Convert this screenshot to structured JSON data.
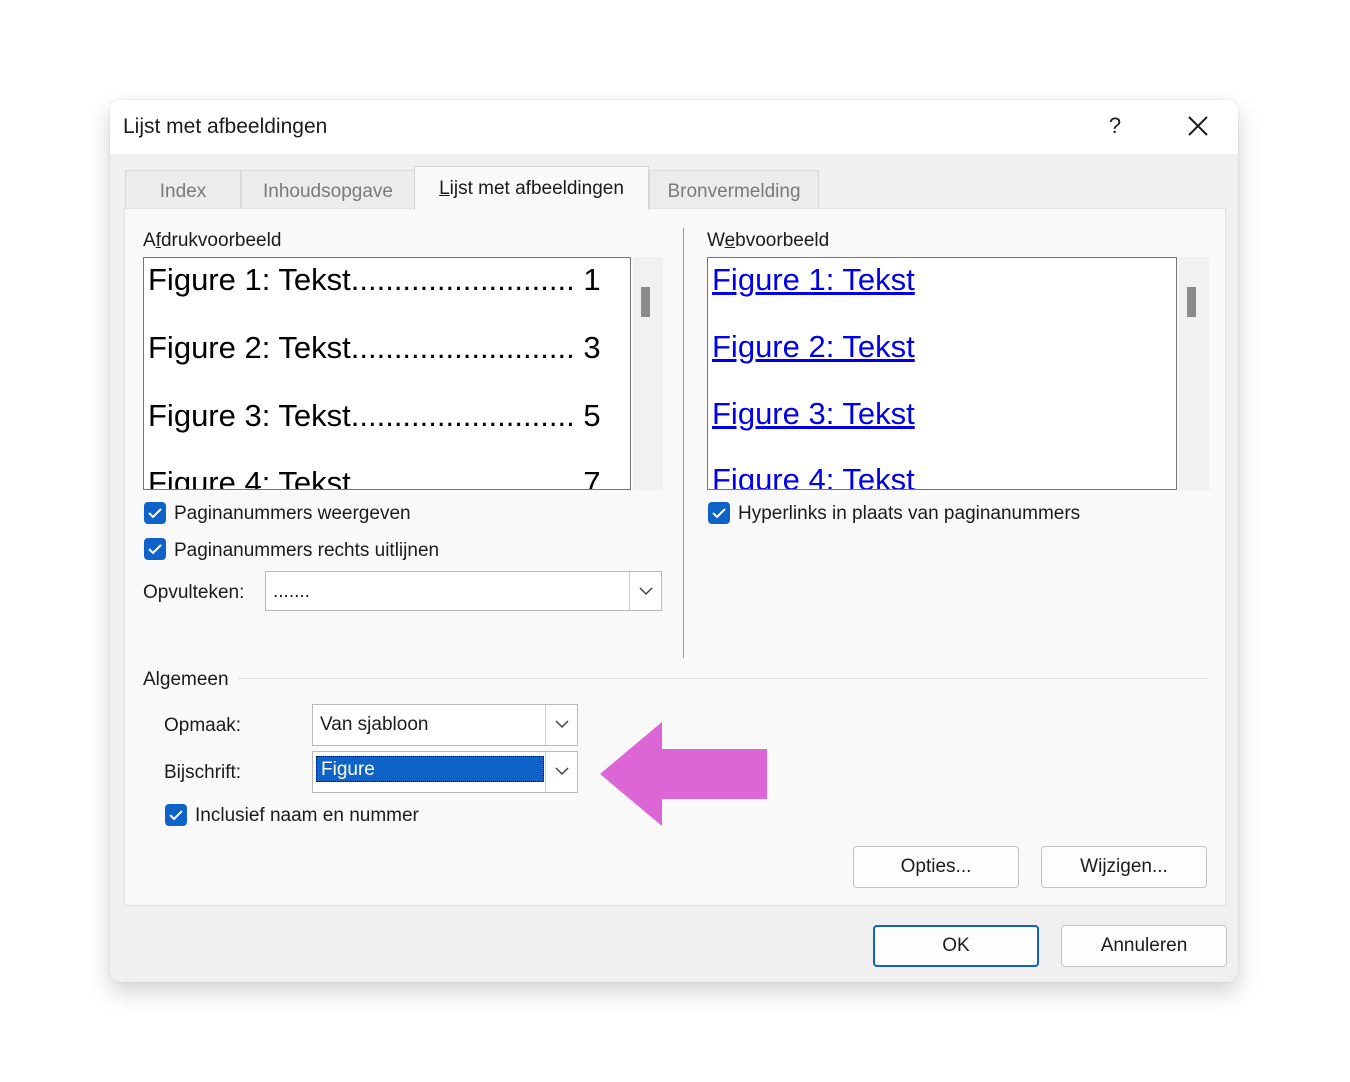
{
  "dialog": {
    "title": "Lijst met afbeeldingen",
    "help_label": "?",
    "close_icon": "close-icon"
  },
  "tabs": [
    {
      "label": "Index",
      "active": false
    },
    {
      "label": "Inhoudsopgave",
      "active": false
    },
    {
      "label": "Lijst met afbeeldingen",
      "active": true
    },
    {
      "label": "Bronvermelding",
      "active": false
    }
  ],
  "print_preview": {
    "label": "Afdrukvoorbeeld",
    "rows": [
      {
        "text": "Figure 1: Tekst",
        "dots": "..........................",
        "page": "1"
      },
      {
        "text": "Figure 2: Tekst",
        "dots": "..........................",
        "page": "3"
      },
      {
        "text": "Figure 3: Tekst",
        "dots": "..........................",
        "page": "5"
      },
      {
        "text": "Figure 4: Tekst",
        "dots": "..........................",
        "page": "7"
      }
    ]
  },
  "web_preview": {
    "label": "Webvoorbeeld",
    "rows": [
      "Figure 1: Tekst",
      "Figure 2: Tekst",
      "Figure 3: Tekst",
      "Figure 4: Tekst"
    ]
  },
  "options": {
    "show_page_numbers": {
      "label": "Paginanummers weergeven",
      "checked": true
    },
    "right_align": {
      "label": "Paginanummers rechts uitlijnen",
      "checked": true
    },
    "hyperlinks": {
      "label": "Hyperlinks in plaats van paginanummers",
      "checked": true
    },
    "tab_leader": {
      "label": "Opvulteken:",
      "value": "......."
    }
  },
  "general": {
    "heading": "Algemeen",
    "format": {
      "label": "Opmaak:",
      "value": "Van sjabloon"
    },
    "caption": {
      "label": "Bijschrift:",
      "value": "Figure"
    },
    "include_label": {
      "label": "Inclusief naam en nummer",
      "checked": true
    }
  },
  "buttons": {
    "options": "Opties...",
    "modify": "Wijzigen...",
    "ok": "OK",
    "cancel": "Annuleren"
  },
  "colors": {
    "accent": "#0f62c7",
    "link": "#0000ee",
    "annotation_arrow": "#dd66d6"
  }
}
